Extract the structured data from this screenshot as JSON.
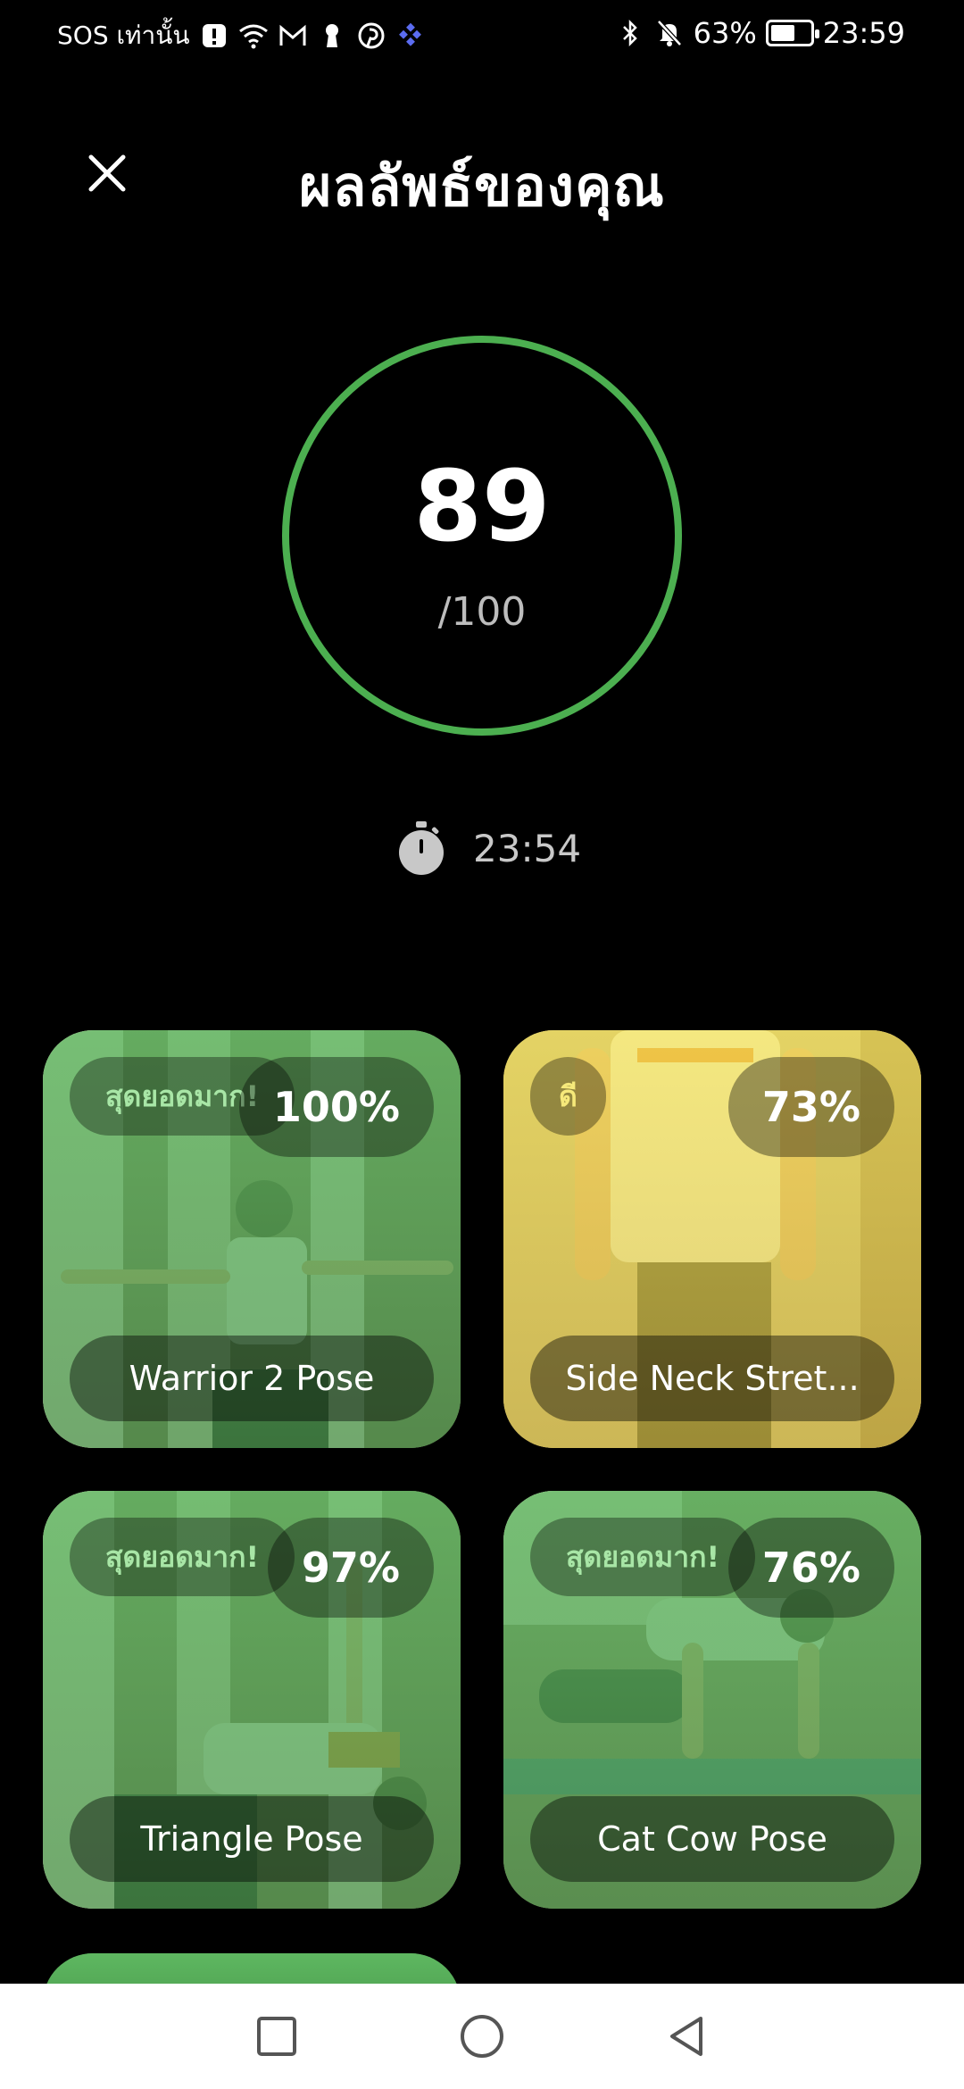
{
  "status_bar": {
    "carrier": "SOS เท่านั้น",
    "battery": "63%",
    "battery_level": 0.63,
    "time": "23:59"
  },
  "header": {
    "title": "ผลลัพธ์ของคุณ"
  },
  "score": {
    "value": "89",
    "max_label": "/100",
    "fraction": 0.89,
    "ring_color": "#4caf50"
  },
  "timer": {
    "duration": "23:54"
  },
  "results": [
    {
      "rating": "สุดยอดมาก!",
      "percent": "100%",
      "name": "Warrior 2 Pose",
      "tone": "green"
    },
    {
      "rating": "ดี",
      "percent": "73%",
      "name": "Side Neck Stret...",
      "tone": "yellow"
    },
    {
      "rating": "สุดยอดมาก!",
      "percent": "97%",
      "name": "Triangle Pose",
      "tone": "green"
    },
    {
      "rating": "สุดยอดมาก!",
      "percent": "76%",
      "name": "Cat Cow Pose",
      "tone": "green"
    }
  ],
  "colors": {
    "accent_green": "#4caf50",
    "card_green": "#55a85a",
    "card_yellow": "#e6d24e"
  }
}
